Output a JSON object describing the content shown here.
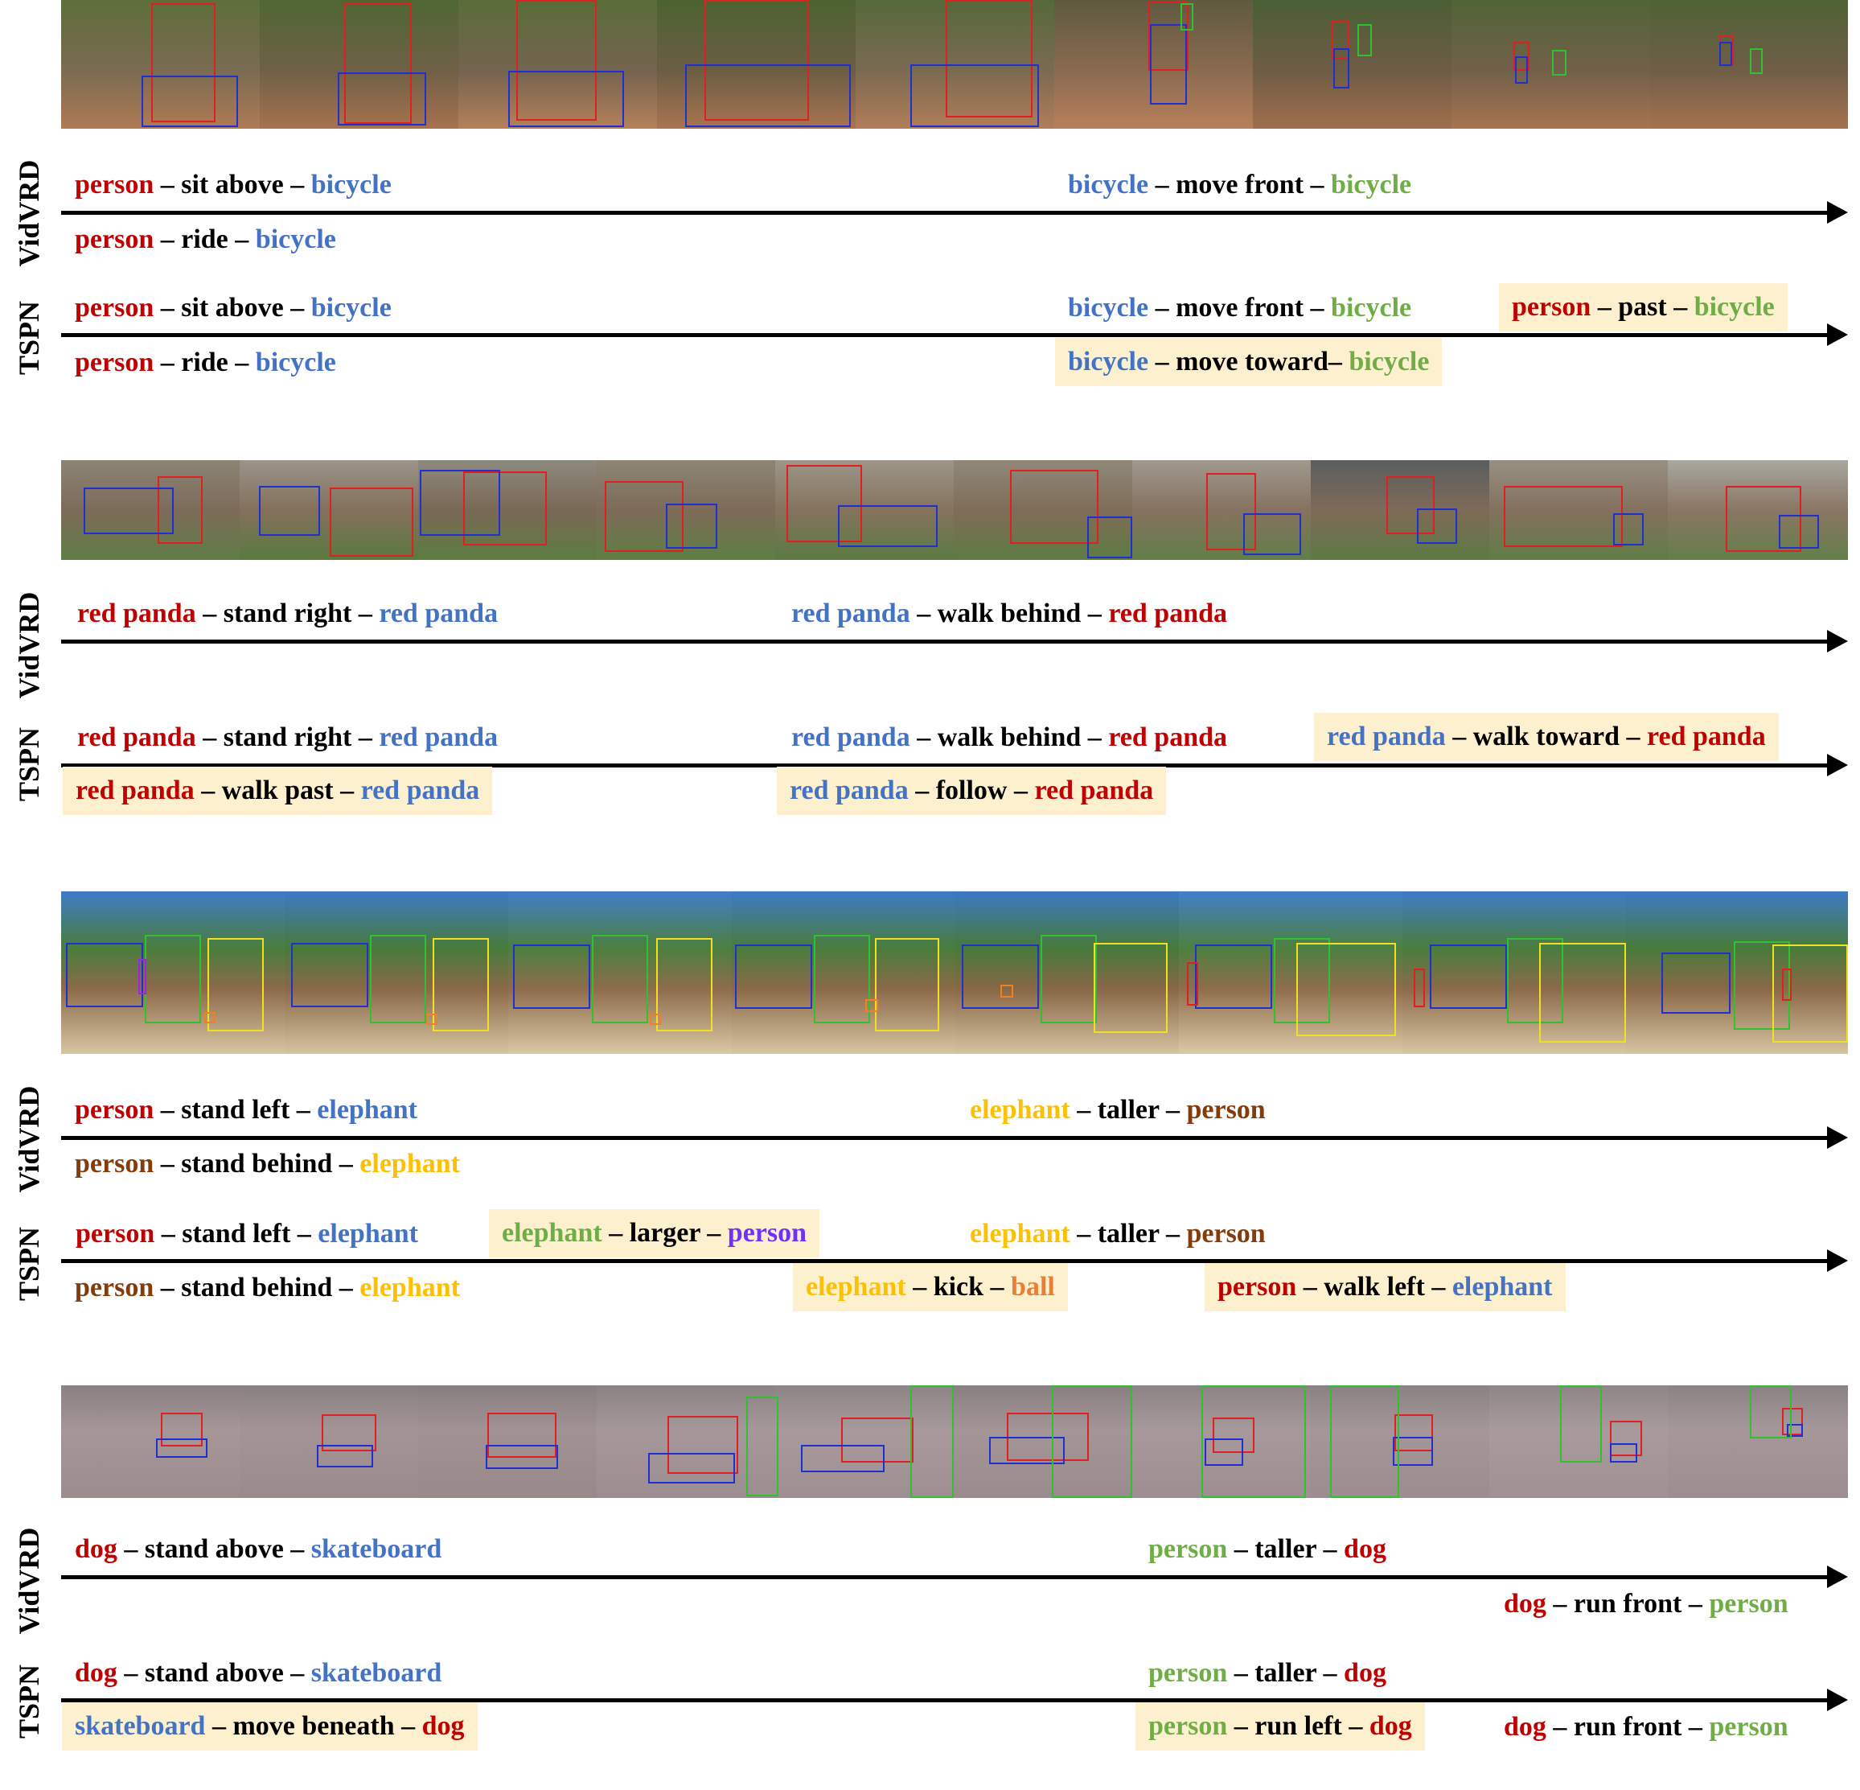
{
  "rows": [
    {
      "id": "bicycle",
      "vidvrd_label": "VidVRD",
      "tspn_label": "TSPN",
      "relations": [
        {
          "track": "vidvrd",
          "parts": [
            {
              "t": "person",
              "c": "red"
            },
            {
              "t": " – sit above – ",
              "c": "black"
            },
            {
              "t": "bicycle",
              "c": "blue"
            }
          ]
        },
        {
          "track": "vidvrd",
          "parts": [
            {
              "t": "bicycle",
              "c": "blue"
            },
            {
              "t": " – move front – ",
              "c": "black"
            },
            {
              "t": "bicycle",
              "c": "green"
            }
          ]
        },
        {
          "track": "vidvrd",
          "parts": [
            {
              "t": "person",
              "c": "red"
            },
            {
              "t": " – ride – ",
              "c": "black"
            },
            {
              "t": "bicycle",
              "c": "blue"
            }
          ]
        },
        {
          "track": "tspn",
          "parts": [
            {
              "t": "person",
              "c": "red"
            },
            {
              "t": " – sit above – ",
              "c": "black"
            },
            {
              "t": "bicycle",
              "c": "blue"
            }
          ]
        },
        {
          "track": "tspn",
          "parts": [
            {
              "t": "bicycle",
              "c": "blue"
            },
            {
              "t": " – move front – ",
              "c": "black"
            },
            {
              "t": "bicycle",
              "c": "green"
            }
          ]
        },
        {
          "track": "tspn",
          "highlight": true,
          "parts": [
            {
              "t": "person",
              "c": "red"
            },
            {
              "t": " – past – ",
              "c": "black"
            },
            {
              "t": "bicycle",
              "c": "green"
            }
          ]
        },
        {
          "track": "tspn",
          "parts": [
            {
              "t": "person",
              "c": "red"
            },
            {
              "t": " – ride – ",
              "c": "black"
            },
            {
              "t": "bicycle",
              "c": "blue"
            }
          ]
        },
        {
          "track": "tspn",
          "highlight": true,
          "parts": [
            {
              "t": "bicycle",
              "c": "blue"
            },
            {
              "t": " – move toward– ",
              "c": "black"
            },
            {
              "t": "bicycle",
              "c": "green"
            }
          ]
        }
      ]
    },
    {
      "id": "red-panda",
      "vidvrd_label": "VidVRD",
      "tspn_label": "TSPN",
      "relations": [
        {
          "track": "vidvrd",
          "parts": [
            {
              "t": "red panda",
              "c": "red"
            },
            {
              "t": " – stand right – ",
              "c": "black"
            },
            {
              "t": "red panda",
              "c": "blue"
            }
          ]
        },
        {
          "track": "vidvrd",
          "parts": [
            {
              "t": "red panda",
              "c": "blue"
            },
            {
              "t": " – walk behind – ",
              "c": "black"
            },
            {
              "t": "red panda",
              "c": "red"
            }
          ]
        },
        {
          "track": "tspn",
          "parts": [
            {
              "t": "red panda",
              "c": "red"
            },
            {
              "t": " – stand right – ",
              "c": "black"
            },
            {
              "t": "red panda",
              "c": "blue"
            }
          ]
        },
        {
          "track": "tspn",
          "parts": [
            {
              "t": "red panda",
              "c": "blue"
            },
            {
              "t": " – walk behind – ",
              "c": "black"
            },
            {
              "t": "red panda",
              "c": "red"
            }
          ]
        },
        {
          "track": "tspn",
          "highlight": true,
          "parts": [
            {
              "t": "red panda",
              "c": "blue"
            },
            {
              "t": " – walk toward – ",
              "c": "black"
            },
            {
              "t": "red panda",
              "c": "red"
            }
          ]
        },
        {
          "track": "tspn",
          "highlight": true,
          "parts": [
            {
              "t": "red panda",
              "c": "red"
            },
            {
              "t": " – walk past – ",
              "c": "black"
            },
            {
              "t": "red panda",
              "c": "blue"
            }
          ]
        },
        {
          "track": "tspn",
          "highlight": true,
          "parts": [
            {
              "t": "red panda",
              "c": "blue"
            },
            {
              "t": " – follow – ",
              "c": "black"
            },
            {
              "t": "red panda",
              "c": "red"
            }
          ]
        }
      ]
    },
    {
      "id": "elephant",
      "vidvrd_label": "VidVRD",
      "tspn_label": "TSPN",
      "relations": [
        {
          "track": "vidvrd",
          "parts": [
            {
              "t": "person",
              "c": "red"
            },
            {
              "t": " – stand left – ",
              "c": "black"
            },
            {
              "t": "elephant",
              "c": "blue"
            }
          ]
        },
        {
          "track": "vidvrd",
          "parts": [
            {
              "t": "elephant",
              "c": "yellow"
            },
            {
              "t": " – taller – ",
              "c": "black"
            },
            {
              "t": "person",
              "c": "brown"
            }
          ]
        },
        {
          "track": "vidvrd",
          "parts": [
            {
              "t": "person",
              "c": "brown"
            },
            {
              "t": " – stand behind – ",
              "c": "black"
            },
            {
              "t": "elephant",
              "c": "yellow"
            }
          ]
        },
        {
          "track": "tspn",
          "parts": [
            {
              "t": "person",
              "c": "red"
            },
            {
              "t": " – stand left – ",
              "c": "black"
            },
            {
              "t": "elephant",
              "c": "blue"
            }
          ]
        },
        {
          "track": "tspn",
          "highlight": true,
          "parts": [
            {
              "t": "elephant",
              "c": "green"
            },
            {
              "t": " – larger – ",
              "c": "black"
            },
            {
              "t": "person",
              "c": "purple"
            }
          ]
        },
        {
          "track": "tspn",
          "parts": [
            {
              "t": "elephant",
              "c": "yellow"
            },
            {
              "t": " – taller – ",
              "c": "black"
            },
            {
              "t": "person",
              "c": "brown"
            }
          ]
        },
        {
          "track": "tspn",
          "parts": [
            {
              "t": "person",
              "c": "brown"
            },
            {
              "t": " – stand behind – ",
              "c": "black"
            },
            {
              "t": "elephant",
              "c": "yellow"
            }
          ]
        },
        {
          "track": "tspn",
          "highlight": true,
          "parts": [
            {
              "t": "elephant",
              "c": "yellow"
            },
            {
              "t": " – kick – ",
              "c": "black"
            },
            {
              "t": "ball",
              "c": "orange"
            }
          ]
        },
        {
          "track": "tspn",
          "highlight": true,
          "parts": [
            {
              "t": "person",
              "c": "red"
            },
            {
              "t": " – walk left – ",
              "c": "black"
            },
            {
              "t": "elephant",
              "c": "blue"
            }
          ]
        }
      ]
    },
    {
      "id": "dog",
      "vidvrd_label": "VidVRD",
      "tspn_label": "TSPN",
      "relations": [
        {
          "track": "vidvrd",
          "parts": [
            {
              "t": "dog",
              "c": "red"
            },
            {
              "t": " – stand above – ",
              "c": "black"
            },
            {
              "t": "skateboard",
              "c": "blue"
            }
          ]
        },
        {
          "track": "vidvrd",
          "parts": [
            {
              "t": "person",
              "c": "green"
            },
            {
              "t": " – taller – ",
              "c": "black"
            },
            {
              "t": "dog",
              "c": "red"
            }
          ]
        },
        {
          "track": "vidvrd",
          "parts": [
            {
              "t": "dog",
              "c": "red"
            },
            {
              "t": " – run front – ",
              "c": "black"
            },
            {
              "t": "person",
              "c": "green"
            }
          ]
        },
        {
          "track": "tspn",
          "parts": [
            {
              "t": "dog",
              "c": "red"
            },
            {
              "t": " – stand above – ",
              "c": "black"
            },
            {
              "t": "skateboard",
              "c": "blue"
            }
          ]
        },
        {
          "track": "tspn",
          "parts": [
            {
              "t": "person",
              "c": "green"
            },
            {
              "t": " – taller – ",
              "c": "black"
            },
            {
              "t": "dog",
              "c": "red"
            }
          ]
        },
        {
          "track": "tspn",
          "highlight": true,
          "parts": [
            {
              "t": "skateboard",
              "c": "blue"
            },
            {
              "t": " – move beneath – ",
              "c": "black"
            },
            {
              "t": "dog",
              "c": "red"
            }
          ]
        },
        {
          "track": "tspn",
          "highlight": true,
          "parts": [
            {
              "t": "person",
              "c": "green"
            },
            {
              "t": " – run left – ",
              "c": "black"
            },
            {
              "t": "dog",
              "c": "red"
            }
          ]
        },
        {
          "track": "tspn",
          "parts": [
            {
              "t": "dog",
              "c": "red"
            },
            {
              "t": " – run front – ",
              "c": "black"
            },
            {
              "t": "person",
              "c": "green"
            }
          ]
        }
      ]
    }
  ],
  "box_colors": {
    "red": "#e02020",
    "blue": "#2030d0",
    "green": "#30c030",
    "yellow": "#f0e020",
    "purple": "#a020f0",
    "orange": "#f08020"
  },
  "scenes": {
    "bicycle": "forest trail, mountain biker",
    "red-panda": "red pandas on logs",
    "elephant": "elephants in a sandy enclosure",
    "dog": "bulldog on a skateboard"
  }
}
